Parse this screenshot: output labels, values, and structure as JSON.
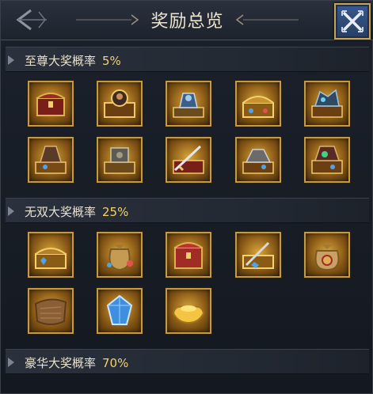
{
  "header": {
    "title": "奖励总览"
  },
  "sections": [
    {
      "label": "至尊大奖概率",
      "pct": "5%"
    },
    {
      "label": "无双大奖概率",
      "pct": "25%"
    },
    {
      "label": "豪华大奖概率",
      "pct": "70%"
    }
  ],
  "colors": {
    "accent_gold": "#f4d26b",
    "frame_gold": "#c79a3c",
    "close_blue": "#3a5a8c"
  },
  "icons": {
    "supreme": [
      "red-chest-icon",
      "portrait-chest-icon",
      "blue-armor-chest-icon",
      "gold-chest-icon",
      "blue-dragon-chest-icon",
      "armor-chest-icon",
      "mech-chest-icon",
      "sword-chest-icon",
      "silver-chest-icon",
      "ornate-chest-icon"
    ],
    "unmatched": [
      "gem-chest-icon",
      "treasure-bag-icon",
      "red-box-icon",
      "scroll-chest-icon",
      "coin-pouch-icon",
      "hide-pelt-icon",
      "blue-gem-icon",
      "gold-ingot-icon"
    ]
  }
}
